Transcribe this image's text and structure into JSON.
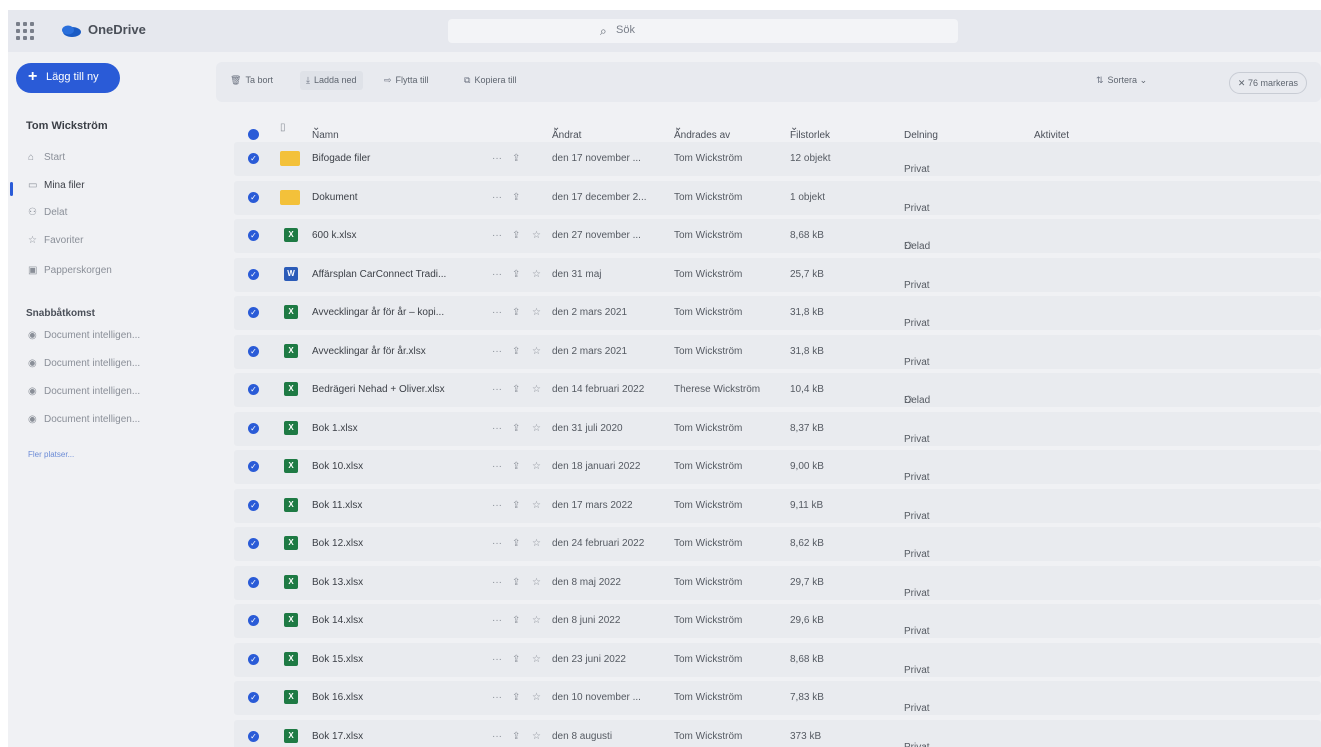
{
  "app": {
    "brand": "OneDrive",
    "search_placeholder": "Sök"
  },
  "sidebar": {
    "add_new": "Lägg till ny",
    "user": "Tom Wickström",
    "items": [
      {
        "label": "Start",
        "icon": "home-icon"
      },
      {
        "label": "Mina filer",
        "icon": "folder-icon",
        "active": true
      },
      {
        "label": "Delat",
        "icon": "people-icon"
      },
      {
        "label": "Favoriter",
        "icon": "star-icon"
      },
      {
        "label": "Papperskorgen",
        "icon": "trash-icon"
      }
    ],
    "quick_access_title": "Snabbåtkomst",
    "quick_access": [
      {
        "label": "Document intelligen..."
      },
      {
        "label": "Document intelligen..."
      },
      {
        "label": "Document intelligen..."
      },
      {
        "label": "Document intelligen..."
      }
    ],
    "more_places": "Fler platser..."
  },
  "toolbar": {
    "delete": "Ta bort",
    "download": "Ladda ned",
    "move_to": "Flytta till",
    "copy_to": "Kopiera till",
    "sort": "Sortera",
    "selected": "76 markeras"
  },
  "columns": {
    "name": "Namn",
    "modified": "Ändrat",
    "modified_by": "Ändrades av",
    "size": "Filstorlek",
    "sharing": "Delning",
    "activity": "Aktivitet"
  },
  "files": [
    {
      "type": "folder",
      "name": "Bifogade filer",
      "modified": "den 17 november ...",
      "by": "Tom Wickström",
      "size": "12 objekt",
      "sharing": "Privat"
    },
    {
      "type": "folder",
      "name": "Dokument",
      "modified": "den 17 december 2...",
      "by": "Tom Wickström",
      "size": "1 objekt",
      "sharing": "Privat"
    },
    {
      "type": "xlsx",
      "name": "600 k.xlsx",
      "modified": "den 27 november ...",
      "by": "Tom Wickström",
      "size": "8,68 kB",
      "sharing": "Delad"
    },
    {
      "type": "docx",
      "name": "Affärsplan CarConnect Tradi...",
      "modified": "den 31 maj",
      "by": "Tom Wickström",
      "size": "25,7 kB",
      "sharing": "Privat"
    },
    {
      "type": "xlsx",
      "name": "Avvecklingar år för år – kopi...",
      "modified": "den 2 mars 2021",
      "by": "Tom Wickström",
      "size": "31,8 kB",
      "sharing": "Privat"
    },
    {
      "type": "xlsx",
      "name": "Avvecklingar år för år.xlsx",
      "modified": "den 2 mars 2021",
      "by": "Tom Wickström",
      "size": "31,8 kB",
      "sharing": "Privat"
    },
    {
      "type": "xlsx",
      "name": "Bedrägeri Nehad + Oliver.xlsx",
      "modified": "den 14 februari 2022",
      "by": "Therese Wickström",
      "size": "10,4 kB",
      "sharing": "Delad"
    },
    {
      "type": "xlsx",
      "name": "Bok 1.xlsx",
      "modified": "den 31 juli 2020",
      "by": "Tom Wickström",
      "size": "8,37 kB",
      "sharing": "Privat"
    },
    {
      "type": "xlsx",
      "name": "Bok 10.xlsx",
      "modified": "den 18 januari 2022",
      "by": "Tom Wickström",
      "size": "9,00 kB",
      "sharing": "Privat"
    },
    {
      "type": "xlsx",
      "name": "Bok 11.xlsx",
      "modified": "den 17 mars 2022",
      "by": "Tom Wickström",
      "size": "9,11 kB",
      "sharing": "Privat"
    },
    {
      "type": "xlsx",
      "name": "Bok 12.xlsx",
      "modified": "den 24 februari 2022",
      "by": "Tom Wickström",
      "size": "8,62 kB",
      "sharing": "Privat"
    },
    {
      "type": "xlsx",
      "name": "Bok 13.xlsx",
      "modified": "den 8 maj 2022",
      "by": "Tom Wickström",
      "size": "29,7 kB",
      "sharing": "Privat"
    },
    {
      "type": "xlsx",
      "name": "Bok 14.xlsx",
      "modified": "den 8 juni 2022",
      "by": "Tom Wickström",
      "size": "29,6 kB",
      "sharing": "Privat"
    },
    {
      "type": "xlsx",
      "name": "Bok 15.xlsx",
      "modified": "den 23 juni 2022",
      "by": "Tom Wickström",
      "size": "8,68 kB",
      "sharing": "Privat"
    },
    {
      "type": "xlsx",
      "name": "Bok 16.xlsx",
      "modified": "den 10 november ...",
      "by": "Tom Wickström",
      "size": "7,83 kB",
      "sharing": "Privat"
    },
    {
      "type": "xlsx",
      "name": "Bok 17.xlsx",
      "modified": "den 8 augusti",
      "by": "Tom Wickström",
      "size": "373 kB",
      "sharing": "Privat"
    }
  ]
}
